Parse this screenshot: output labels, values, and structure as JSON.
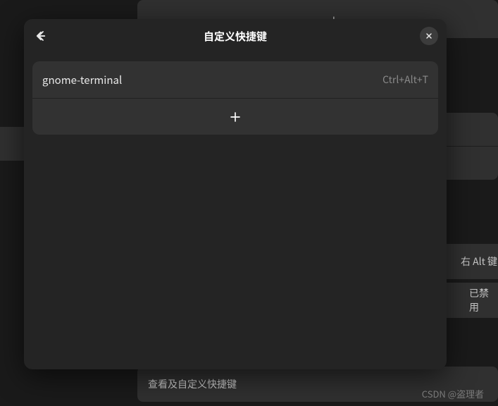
{
  "modal": {
    "title": "自定义快捷键",
    "shortcuts": [
      {
        "name": "gnome-terminal",
        "keys": "Ctrl+Alt+T"
      }
    ]
  },
  "background": {
    "row_alt_label": "右 Alt 键",
    "row_disabled_label": "已禁用",
    "footer_label": "查看及自定义快捷键"
  },
  "watermark": "CSDN @盗理者"
}
